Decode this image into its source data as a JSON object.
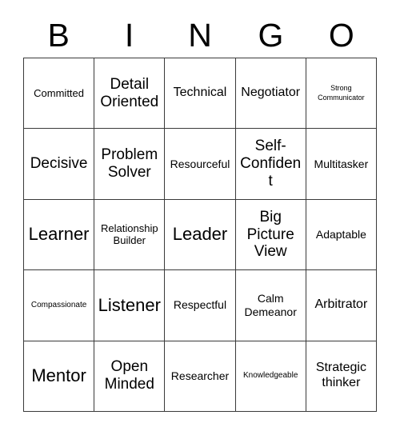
{
  "card": {
    "title": "BINGO",
    "header_letters": [
      "B",
      "I",
      "N",
      "G",
      "O"
    ],
    "grid_size": "5x5",
    "border_color": "#3a3a3a",
    "text_color": "#000000",
    "background_color": "#ffffff"
  },
  "cells": [
    {
      "text": "Committed",
      "size": "fs-m"
    },
    {
      "text": "Detail Oriented",
      "size": "fs-xl"
    },
    {
      "text": "Technical",
      "size": "fs-l"
    },
    {
      "text": "Negotiator",
      "size": "fs-l"
    },
    {
      "text": "Strong Communicator",
      "size": "fs-xs"
    },
    {
      "text": "Decisive",
      "size": "fs-xl"
    },
    {
      "text": "Problem Solver",
      "size": "fs-xl"
    },
    {
      "text": "Resourceful",
      "size": "fs-ml"
    },
    {
      "text": "Self-Confident",
      "size": "fs-xl"
    },
    {
      "text": "Multitasker",
      "size": "fs-ml"
    },
    {
      "text": "Learner",
      "size": "fs-xxl"
    },
    {
      "text": "Relationship Builder",
      "size": "fs-m"
    },
    {
      "text": "Leader",
      "size": "fs-xxl"
    },
    {
      "text": "Big Picture View",
      "size": "fs-xl"
    },
    {
      "text": "Adaptable",
      "size": "fs-ml"
    },
    {
      "text": "Compassionate",
      "size": "fs-s"
    },
    {
      "text": "Listener",
      "size": "fs-xxl"
    },
    {
      "text": "Respectful",
      "size": "fs-ml"
    },
    {
      "text": "Calm Demeanor",
      "size": "fs-ml"
    },
    {
      "text": "Arbitrator",
      "size": "fs-l"
    },
    {
      "text": "Mentor",
      "size": "fs-xxl"
    },
    {
      "text": "Open Minded",
      "size": "fs-xl"
    },
    {
      "text": "Researcher",
      "size": "fs-ml"
    },
    {
      "text": "Knowledgeable",
      "size": "fs-s"
    },
    {
      "text": "Strategic thinker",
      "size": "fs-l"
    }
  ]
}
